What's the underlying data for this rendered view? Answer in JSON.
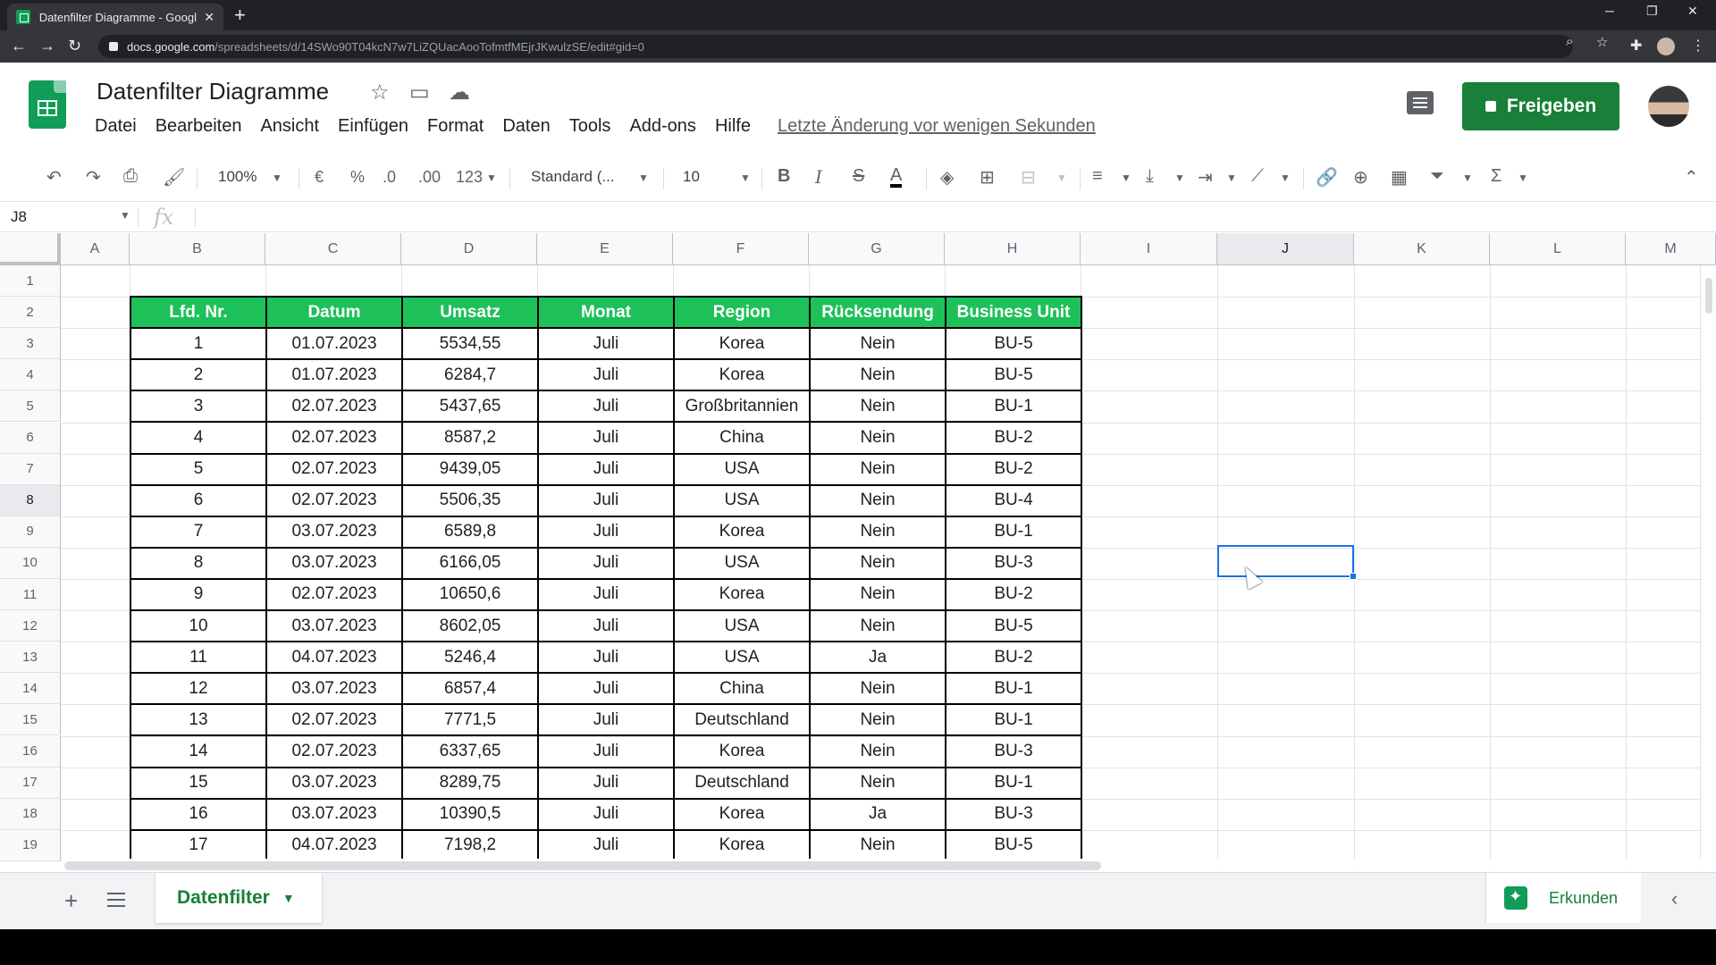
{
  "browser": {
    "tab_title": "Datenfilter Diagramme - Google",
    "tab_close": "✕",
    "newtab": "+",
    "url_host": "docs.google.com",
    "url_path": "/spreadsheets/d/14SWo90T04kcN7w7LiZQUacAooTofmtfMEjrJKwulzSE/edit#gid=0"
  },
  "doc": {
    "title": "Datenfilter Diagramme",
    "menu": [
      "Datei",
      "Bearbeiten",
      "Ansicht",
      "Einfügen",
      "Format",
      "Daten",
      "Tools",
      "Add-ons",
      "Hilfe"
    ],
    "last_edit": "Letzte Änderung vor wenigen Sekunden",
    "share_label": "Freigeben"
  },
  "toolbar": {
    "zoom": "100%",
    "currency": "€",
    "percent": "%",
    "dec_less": ".0",
    "dec_more": ".00",
    "more_formats": "123",
    "font": "Standard (...",
    "font_size": "10"
  },
  "formula_bar": {
    "cell_ref": "J8",
    "fx": "fx"
  },
  "grid": {
    "columns": [
      "A",
      "B",
      "C",
      "D",
      "E",
      "F",
      "G",
      "H",
      "I",
      "J",
      "K",
      "L",
      "M"
    ],
    "selected_column": "J",
    "rows": [
      "1",
      "2",
      "3",
      "4",
      "5",
      "6",
      "7",
      "8",
      "9",
      "10",
      "11",
      "12",
      "13",
      "14",
      "15",
      "16",
      "17",
      "18",
      "19"
    ],
    "selected_row": "8"
  },
  "table": {
    "headers": [
      "Lfd. Nr.",
      "Datum",
      "Umsatz",
      "Monat",
      "Region",
      "Rücksendung",
      "Business Unit"
    ],
    "rows": [
      [
        "1",
        "01.07.2023",
        "5534,55",
        "Juli",
        "Korea",
        "Nein",
        "BU-5"
      ],
      [
        "2",
        "01.07.2023",
        "6284,7",
        "Juli",
        "Korea",
        "Nein",
        "BU-5"
      ],
      [
        "3",
        "02.07.2023",
        "5437,65",
        "Juli",
        "Großbritannien",
        "Nein",
        "BU-1"
      ],
      [
        "4",
        "02.07.2023",
        "8587,2",
        "Juli",
        "China",
        "Nein",
        "BU-2"
      ],
      [
        "5",
        "02.07.2023",
        "9439,05",
        "Juli",
        "USA",
        "Nein",
        "BU-2"
      ],
      [
        "6",
        "02.07.2023",
        "5506,35",
        "Juli",
        "USA",
        "Nein",
        "BU-4"
      ],
      [
        "7",
        "03.07.2023",
        "6589,8",
        "Juli",
        "Korea",
        "Nein",
        "BU-1"
      ],
      [
        "8",
        "03.07.2023",
        "6166,05",
        "Juli",
        "USA",
        "Nein",
        "BU-3"
      ],
      [
        "9",
        "02.07.2023",
        "10650,6",
        "Juli",
        "Korea",
        "Nein",
        "BU-2"
      ],
      [
        "10",
        "03.07.2023",
        "8602,05",
        "Juli",
        "USA",
        "Nein",
        "BU-5"
      ],
      [
        "11",
        "04.07.2023",
        "5246,4",
        "Juli",
        "USA",
        "Ja",
        "BU-2"
      ],
      [
        "12",
        "03.07.2023",
        "6857,4",
        "Juli",
        "China",
        "Nein",
        "BU-1"
      ],
      [
        "13",
        "02.07.2023",
        "7771,5",
        "Juli",
        "Deutschland",
        "Nein",
        "BU-1"
      ],
      [
        "14",
        "02.07.2023",
        "6337,65",
        "Juli",
        "Korea",
        "Nein",
        "BU-3"
      ],
      [
        "15",
        "03.07.2023",
        "8289,75",
        "Juli",
        "Deutschland",
        "Nein",
        "BU-1"
      ],
      [
        "16",
        "03.07.2023",
        "10390,5",
        "Juli",
        "Korea",
        "Ja",
        "BU-3"
      ],
      [
        "17",
        "04.07.2023",
        "7198,2",
        "Juli",
        "Korea",
        "Nein",
        "BU-5"
      ]
    ]
  },
  "sheets": {
    "add": "+",
    "active_tab": "Datenfilter",
    "explore": "Erkunden"
  },
  "colors": {
    "header_green": "#1ec05a",
    "brand_green": "#188038",
    "selection_blue": "#1a73e8"
  }
}
